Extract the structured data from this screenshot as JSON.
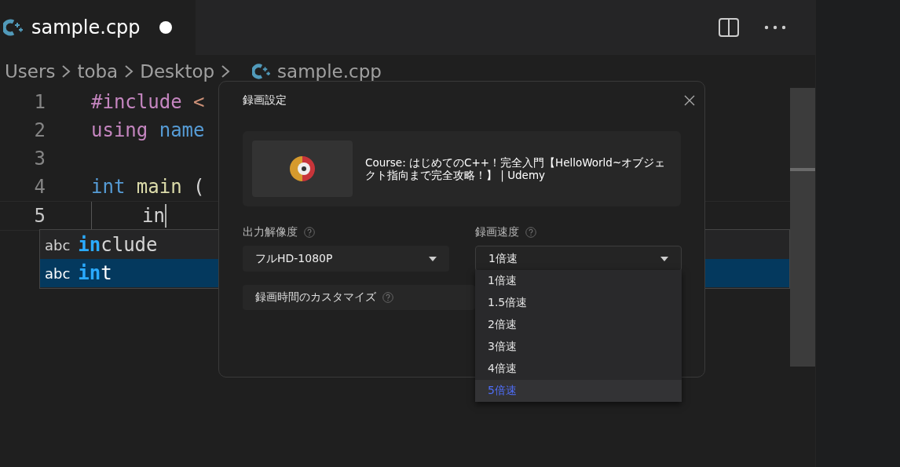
{
  "tab": {
    "filename": "sample.cpp",
    "modified": true
  },
  "breadcrumb": [
    "Users",
    "toba",
    "Desktop",
    "sample.cpp"
  ],
  "code_lines": [
    {
      "number": "1",
      "tokens": [
        {
          "kind": "directive",
          "text": "#include"
        },
        {
          "kind": "string",
          "text": " <"
        }
      ]
    },
    {
      "number": "2",
      "tokens": [
        {
          "kind": "directive",
          "text": "using"
        },
        {
          "kind": "type",
          "text": " name"
        }
      ]
    },
    {
      "number": "3"
    },
    {
      "number": "4",
      "tokens": [
        {
          "kind": "type",
          "text": "int"
        },
        {
          "kind": "function",
          "text": " main"
        },
        {
          "kind": "plain",
          "text": " ("
        }
      ]
    },
    {
      "number": "5",
      "current": true,
      "tokens": [
        {
          "kind": "plain",
          "text": "in"
        }
      ]
    }
  ],
  "suggestions": [
    {
      "kind_label": "abc",
      "match": "in",
      "rest": "clude",
      "selected": false
    },
    {
      "kind_label": "abc",
      "match": "in",
      "rest": "t",
      "selected": true
    }
  ],
  "dialog": {
    "title": "録画設定",
    "course": "Course: はじめてのC++！完全入門【HelloWorld~オブジェクト指向まで完全攻略！】 | Udemy",
    "resolution": {
      "label": "出力解像度",
      "value": "フルHD-1080P"
    },
    "speed": {
      "label": "録画速度",
      "value": "1倍速",
      "options": [
        {
          "label": "1倍速",
          "highlighted": false
        },
        {
          "label": "1.5倍速",
          "highlighted": false
        },
        {
          "label": "2倍速",
          "highlighted": false
        },
        {
          "label": "3倍速",
          "highlighted": false
        },
        {
          "label": "4倍速",
          "highlighted": false
        },
        {
          "label": "5倍速",
          "highlighted": true
        }
      ]
    },
    "custom_time": {
      "label": "録画時間のカスタマイズ"
    }
  }
}
